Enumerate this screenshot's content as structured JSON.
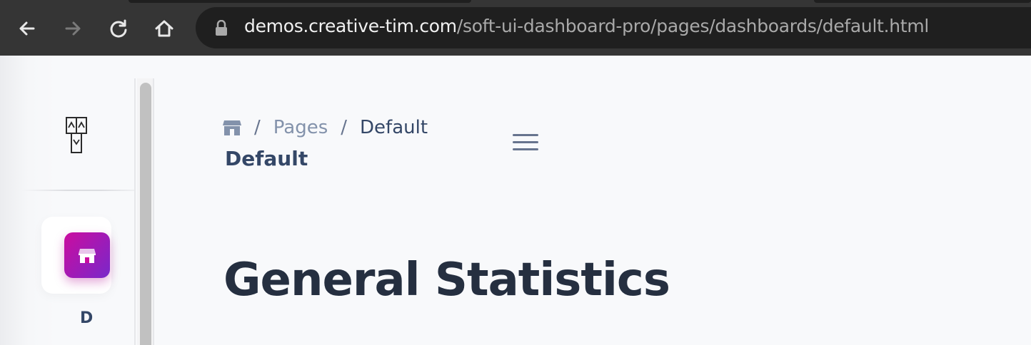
{
  "browser": {
    "url_host": "demos.creative-tim.com",
    "url_path": "/soft-ui-dashboard-pro/pages/dashboards/default.html",
    "icons": [
      "back-arrow-icon",
      "forward-arrow-icon",
      "reload-icon",
      "home-icon",
      "lock-icon"
    ]
  },
  "sidebar": {
    "logo_icon": "logo-icon",
    "active_item": {
      "icon": "shop-icon",
      "label": "D"
    }
  },
  "header": {
    "breadcrumb": {
      "home_icon": "shop-icon",
      "separator": "/",
      "items": [
        "Pages",
        "Default"
      ]
    },
    "title": "Default",
    "menu_icon": "hamburger-icon"
  },
  "main": {
    "heading": "General Statistics"
  },
  "colors": {
    "accent_gradient_start": "#7928ca",
    "accent_gradient_end": "#cb0c9f",
    "text_dark": "#344767",
    "text_muted": "#8392ab",
    "heading": "#252f40"
  }
}
